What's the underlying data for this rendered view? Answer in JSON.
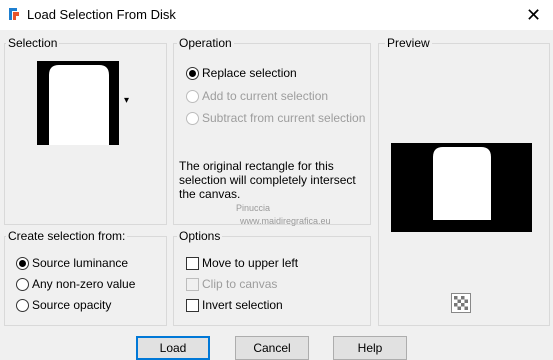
{
  "window": {
    "title": "Load Selection From Disk",
    "close_glyph": "✕"
  },
  "selection": {
    "legend": "Selection",
    "dropdown_glyph": "▾"
  },
  "operation": {
    "legend": "Operation",
    "options": [
      {
        "label": "Replace selection",
        "checked": true,
        "enabled": true
      },
      {
        "label": "Add to current selection",
        "checked": false,
        "enabled": false
      },
      {
        "label": "Subtract from current selection",
        "checked": false,
        "enabled": false
      }
    ],
    "description_lines": [
      "The original rectangle for this",
      "selection will completely intersect",
      "the canvas."
    ]
  },
  "preview": {
    "legend": "Preview"
  },
  "create_from": {
    "legend": "Create selection from:",
    "options": [
      {
        "label": "Source luminance",
        "checked": true
      },
      {
        "label": "Any non-zero value",
        "checked": false
      },
      {
        "label": "Source opacity",
        "checked": false
      }
    ]
  },
  "options": {
    "legend": "Options",
    "items": [
      {
        "label": "Move to upper left",
        "checked": false,
        "enabled": true
      },
      {
        "label": "Clip to canvas",
        "checked": false,
        "enabled": false
      },
      {
        "label": "Invert selection",
        "checked": false,
        "enabled": true
      }
    ]
  },
  "buttons": {
    "load": "Load",
    "cancel": "Cancel",
    "help": "Help"
  },
  "watermark": {
    "line1": "Pinuccia",
    "line2": "www.maidiregrafica.eu"
  },
  "colors": {
    "accent": "#0078d7"
  }
}
